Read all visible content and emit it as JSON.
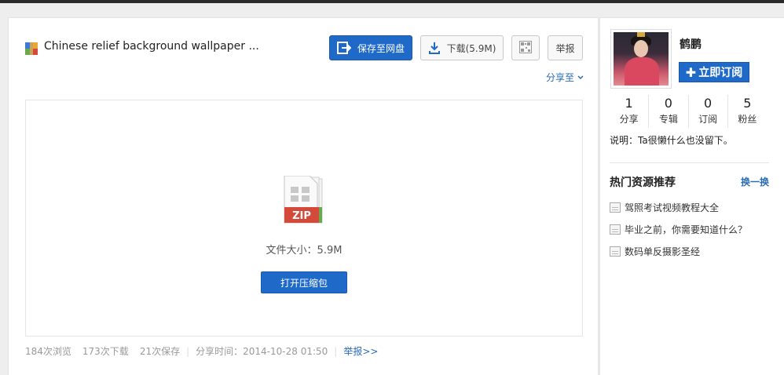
{
  "file": {
    "title": "Chinese relief background wallpaper ...",
    "size_text": "文件大小：5.9M",
    "type_badge": "ZIP"
  },
  "toolbar": {
    "save_label": "保存至网盘",
    "download_label": "下载(5.9M)",
    "report_label": "举报",
    "share_label": "分享至"
  },
  "preview": {
    "open_label": "打开压缩包"
  },
  "stats": {
    "views": "184次浏览",
    "downloads": "173次下载",
    "saves": "21次保存",
    "share_time": "分享时间：2014-10-28 01:50",
    "report_link": "举报>>"
  },
  "user": {
    "name": "鹤鹏",
    "subscribe_label": "立即订阅",
    "counts": [
      {
        "num": "1",
        "label": "分享"
      },
      {
        "num": "0",
        "label": "专辑"
      },
      {
        "num": "0",
        "label": "订阅"
      },
      {
        "num": "5",
        "label": "粉丝"
      }
    ],
    "description": "说明：Ta很懒什么也没留下。"
  },
  "hot": {
    "title": "热门资源推荐",
    "refresh_label": "换一换",
    "items": [
      {
        "label": "驾照考试视频教程大全"
      },
      {
        "label": "毕业之前，你需要知道什么？"
      },
      {
        "label": "数码单反摄影圣经"
      }
    ]
  },
  "colors": {
    "accent": "#1f6ac8",
    "link": "#2a6bb5",
    "zip_red": "#d44a3a",
    "zip_green": "#6aa84f"
  }
}
